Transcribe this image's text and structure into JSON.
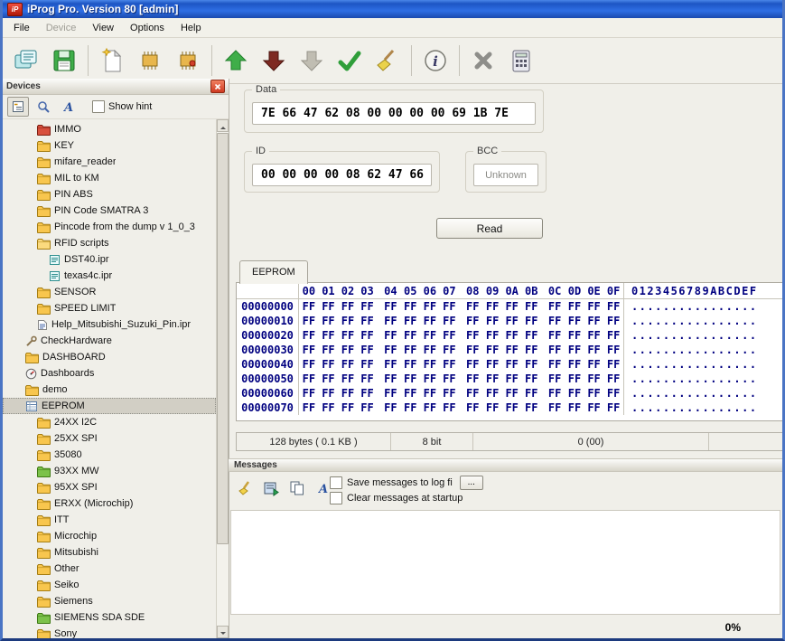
{
  "window": {
    "title": "iProg Pro. Version 80 [admin]",
    "icon_label": "iP"
  },
  "menu": {
    "items": [
      {
        "label": "File",
        "enabled": true
      },
      {
        "label": "Device",
        "enabled": false
      },
      {
        "label": "View",
        "enabled": true
      },
      {
        "label": "Options",
        "enabled": true
      },
      {
        "label": "Help",
        "enabled": true
      }
    ]
  },
  "toolbar": {
    "buttons": [
      {
        "name": "open-scripts-button",
        "icon": "notes-icon"
      },
      {
        "name": "save-button",
        "icon": "save-icon"
      },
      {
        "sep": true
      },
      {
        "name": "new-file-button",
        "icon": "new-page-icon"
      },
      {
        "name": "select-device-button",
        "icon": "chip-icon"
      },
      {
        "name": "device-options-button",
        "icon": "chip2-icon"
      },
      {
        "sep": true
      },
      {
        "name": "read-device-button",
        "icon": "arrow-up-icon"
      },
      {
        "name": "write-device-button",
        "icon": "arrow-down-icon"
      },
      {
        "name": "write-partial-button",
        "icon": "arrow-down-gray-icon",
        "disabled": true
      },
      {
        "name": "verify-button",
        "icon": "check-icon"
      },
      {
        "name": "erase-button",
        "icon": "broom-icon"
      },
      {
        "sep": true
      },
      {
        "name": "info-button",
        "icon": "info-icon"
      },
      {
        "sep": true
      },
      {
        "name": "cancel-button",
        "icon": "close-x-icon"
      },
      {
        "name": "calculator-button",
        "icon": "calculator-icon"
      }
    ]
  },
  "devices_panel": {
    "title": "Devices",
    "toolbar": [
      {
        "name": "tree-view-button",
        "icon": "tree-view-icon",
        "pressed": true
      },
      {
        "name": "search-button",
        "icon": "search-icon"
      },
      {
        "name": "font-button",
        "icon": "font-a-icon"
      }
    ],
    "show_hint_label": "Show hint",
    "tree": [
      {
        "label": "IMMO",
        "icon": "folder-red",
        "indent": 2
      },
      {
        "label": "KEY",
        "icon": "folder",
        "indent": 2
      },
      {
        "label": "mifare_reader",
        "icon": "folder",
        "indent": 2
      },
      {
        "label": "MIL to KM",
        "icon": "folder",
        "indent": 2
      },
      {
        "label": "PIN ABS",
        "icon": "folder",
        "indent": 2
      },
      {
        "label": "PIN Code SMATRA 3",
        "icon": "folder",
        "indent": 2
      },
      {
        "label": "Pincode from the dump v 1_0_3",
        "icon": "folder",
        "indent": 2
      },
      {
        "label": "RFID scripts",
        "icon": "folder-open",
        "indent": 2
      },
      {
        "label": "DST40.ipr",
        "icon": "file-ipr",
        "indent": 3
      },
      {
        "label": "texas4c.ipr",
        "icon": "file-ipr",
        "indent": 3
      },
      {
        "label": "SENSOR",
        "icon": "folder",
        "indent": 2
      },
      {
        "label": "SPEED LIMIT",
        "icon": "folder",
        "indent": 2
      },
      {
        "label": "Help_Mitsubishi_Suzuki_Pin.ipr",
        "icon": "doc",
        "indent": 2
      },
      {
        "label": "CheckHardware",
        "icon": "wrench",
        "indent": 1
      },
      {
        "label": "DASHBOARD",
        "icon": "folder",
        "indent": 1
      },
      {
        "label": "Dashboards",
        "icon": "gauge",
        "indent": 1
      },
      {
        "label": "demo",
        "icon": "folder",
        "indent": 1
      },
      {
        "label": "EEPROM",
        "icon": "list",
        "indent": 1,
        "selected": true
      },
      {
        "label": "24XX I2C",
        "icon": "folder",
        "indent": 2
      },
      {
        "label": "25XX SPI",
        "icon": "folder",
        "indent": 2
      },
      {
        "label": "35080",
        "icon": "folder",
        "indent": 2
      },
      {
        "label": "93XX MW",
        "icon": "folder-green",
        "indent": 2
      },
      {
        "label": "95XX SPI",
        "icon": "folder",
        "indent": 2
      },
      {
        "label": "ERXX (Microchip)",
        "icon": "folder",
        "indent": 2
      },
      {
        "label": "ITT",
        "icon": "folder",
        "indent": 2
      },
      {
        "label": "Microchip",
        "icon": "folder",
        "indent": 2
      },
      {
        "label": "Mitsubishi",
        "icon": "folder",
        "indent": 2
      },
      {
        "label": "Other",
        "icon": "folder",
        "indent": 2
      },
      {
        "label": "Seiko",
        "icon": "folder",
        "indent": 2
      },
      {
        "label": "Siemens",
        "icon": "folder",
        "indent": 2
      },
      {
        "label": "SIEMENS SDA SDE",
        "icon": "folder-green",
        "indent": 2
      },
      {
        "label": "Sony",
        "icon": "folder",
        "indent": 2
      }
    ]
  },
  "groups": {
    "data": {
      "label": "Data",
      "value": "7E 66 47 62 08 00 00 00 00 69 1B 7E"
    },
    "id": {
      "label": "ID",
      "value": "00 00 00 00 08 62 47 66"
    },
    "bcc": {
      "label": "BCC",
      "value": "Unknown"
    }
  },
  "read_button_label": "Read",
  "eeprom_tab_label": "EEPROM",
  "hex_view": {
    "col_headers": [
      "00",
      "01",
      "02",
      "03",
      "04",
      "05",
      "06",
      "07",
      "08",
      "09",
      "0A",
      "0B",
      "0C",
      "0D",
      "0E",
      "0F"
    ],
    "ascii_header": "0123456789ABCDEF",
    "rows": [
      {
        "addr": "00000000",
        "bytes": "FF FF FF FF FF FF FF FF FF FF FF FF FF FF FF FF",
        "ascii": "................"
      },
      {
        "addr": "00000010",
        "bytes": "FF FF FF FF FF FF FF FF FF FF FF FF FF FF FF FF",
        "ascii": "................"
      },
      {
        "addr": "00000020",
        "bytes": "FF FF FF FF FF FF FF FF FF FF FF FF FF FF FF FF",
        "ascii": "................"
      },
      {
        "addr": "00000030",
        "bytes": "FF FF FF FF FF FF FF FF FF FF FF FF FF FF FF FF",
        "ascii": "................"
      },
      {
        "addr": "00000040",
        "bytes": "FF FF FF FF FF FF FF FF FF FF FF FF FF FF FF FF",
        "ascii": "................"
      },
      {
        "addr": "00000050",
        "bytes": "FF FF FF FF FF FF FF FF FF FF FF FF FF FF FF FF",
        "ascii": "................"
      },
      {
        "addr": "00000060",
        "bytes": "FF FF FF FF FF FF FF FF FF FF FF FF FF FF FF FF",
        "ascii": "................"
      },
      {
        "addr": "00000070",
        "bytes": "FF FF FF FF FF FF FF FF FF FF FF FF FF FF FF FF",
        "ascii": "................"
      }
    ]
  },
  "status": {
    "size": "128 bytes ( 0.1 KB )",
    "mode": "8 bit",
    "value": "0 (00)"
  },
  "messages": {
    "title": "Messages",
    "toolbar": [
      {
        "name": "clear-messages-button",
        "icon": "brush-icon"
      },
      {
        "name": "save-log-button",
        "icon": "export-icon"
      },
      {
        "name": "copy-messages-button",
        "icon": "copy-icon"
      },
      {
        "name": "font-messages-button",
        "icon": "font-a-icon"
      }
    ],
    "save_checkbox_label": "Save messages to log fi",
    "browse_button_label": "...",
    "clear_checkbox_label": "Clear messages at startup"
  },
  "progress_label": "0%"
}
